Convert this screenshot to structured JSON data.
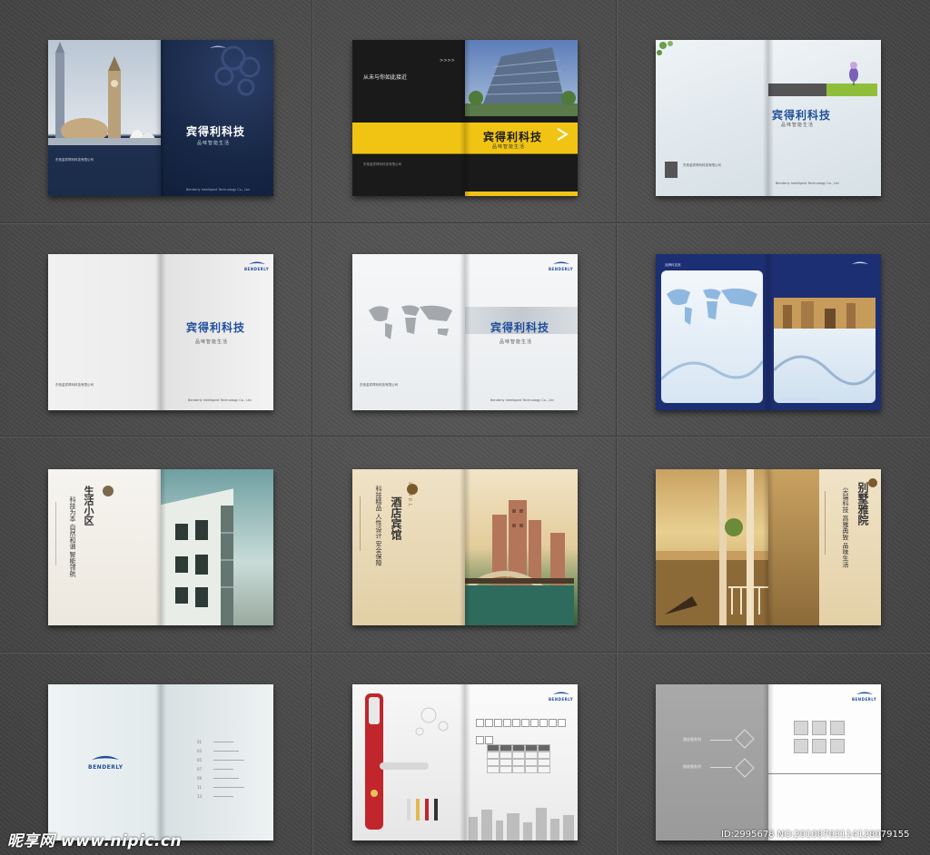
{
  "brand": {
    "company_cn": "宾得利科技",
    "slogan_cn": "品味智能生活",
    "logo_name": "BENDERLY",
    "company_en": "Benderly Intelligent Technology Co., Ltd",
    "company_cn_full": "东莞金宾得利科技有限公司"
  },
  "cover2_tagline": "从未与你如此接近",
  "cover6_labels": {
    "top_left": "品牌科技馆"
  },
  "panel7": {
    "heading": "生活小区",
    "headline": "科技为本  自然和谐  智能领航"
  },
  "panel8": {
    "heading": "酒店宾馆",
    "sub": "HOTEL",
    "headline": "科技精品  人性设计  安全保障"
  },
  "panel9": {
    "heading": "别墅雅院",
    "headline": "尖端科技  高雅典致  品味生活"
  },
  "panel10": {
    "toc_numbers": [
      "01",
      "03",
      "05",
      "07",
      "09",
      "11",
      "13"
    ]
  },
  "panel12": {
    "series": [
      "酒店锁系列",
      "指纹锁系列"
    ]
  },
  "watermark": {
    "left": "昵享网 www.nipic.cn",
    "right": "ID:2995678 NO:20100703114128079155"
  }
}
